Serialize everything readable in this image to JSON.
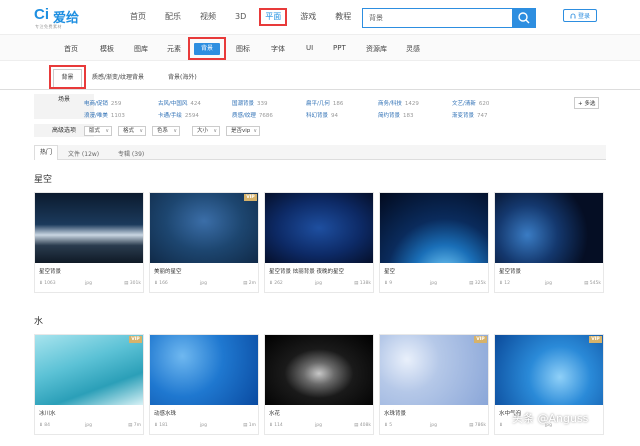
{
  "brand": {
    "name": "爱给",
    "slogan": "专注免费素材"
  },
  "topnav": {
    "items": [
      "首页",
      "配乐",
      "视频",
      "3D",
      "平面",
      "游戏",
      "教程"
    ],
    "active": "平面"
  },
  "search": {
    "value": "背景"
  },
  "login": {
    "label": "登录"
  },
  "catnav": {
    "items": [
      "首页",
      "模板",
      "图库",
      "元素",
      "背景",
      "图标",
      "字体",
      "UI",
      "PPT",
      "资源库",
      "灵感"
    ],
    "active": "背景"
  },
  "subtabs": {
    "items": [
      "背景",
      "质感/渐变/纹理背景",
      "背景(海外)"
    ],
    "active": "背景"
  },
  "filters": {
    "scene_label": "场景",
    "row1": [
      {
        "name": "电商/促销",
        "count": "259"
      },
      {
        "name": "古风/中国风",
        "count": "424"
      },
      {
        "name": "国潮背景",
        "count": "339"
      },
      {
        "name": "扁平/几何",
        "count": "186"
      },
      {
        "name": "商务/科技",
        "count": "1429"
      },
      {
        "name": "文艺/清新",
        "count": "620"
      }
    ],
    "row2": [
      {
        "name": "浪漫/唯美",
        "count": "1103"
      },
      {
        "name": "卡通/手绘",
        "count": "2594"
      },
      {
        "name": "质感/纹理",
        "count": "7686"
      },
      {
        "name": "科幻背景",
        "count": "94"
      },
      {
        "name": "简约背景",
        "count": "183"
      },
      {
        "name": "渐变背景",
        "count": "747"
      }
    ],
    "more": "+ 多选",
    "adv_label": "高级选项",
    "selects": [
      "版式",
      "格式",
      "色系",
      "大小",
      "是否vip"
    ]
  },
  "typetabs": {
    "items": [
      "热门",
      "文件 (12w)",
      "专辑 (39)"
    ],
    "active": "热门"
  },
  "sections": [
    {
      "title": "星空",
      "cards": [
        {
          "title": "星空背景",
          "downloads": "1063",
          "format": "jpg",
          "size": "301k",
          "vip": false
        },
        {
          "title": "美丽的星空",
          "downloads": "166",
          "format": "jpg",
          "size": "2m",
          "vip": true
        },
        {
          "title": "星空背景 炫丽背景 夜晚的星空",
          "downloads": "262",
          "format": "jpg",
          "size": "138k",
          "vip": false
        },
        {
          "title": "星空",
          "downloads": "9",
          "format": "jpg",
          "size": "325k",
          "vip": false
        },
        {
          "title": "星空背景",
          "downloads": "12",
          "format": "jpg",
          "size": "545k",
          "vip": false
        }
      ]
    },
    {
      "title": "水",
      "cards": [
        {
          "title": "冰川水",
          "downloads": "84",
          "format": "jpg",
          "size": "7m",
          "vip": true
        },
        {
          "title": "动感水珠",
          "downloads": "181",
          "format": "jpg",
          "size": "1m",
          "vip": false
        },
        {
          "title": "水花",
          "downloads": "114",
          "format": "jpg",
          "size": "408k",
          "vip": false
        },
        {
          "title": "水珠背景",
          "downloads": "5",
          "format": "jpg",
          "size": "786k",
          "vip": true
        },
        {
          "title": "水中气泡",
          "downloads": "",
          "format": "jpg",
          "size": "",
          "vip": true
        }
      ]
    }
  ],
  "watermark": "头条 @Anguss"
}
